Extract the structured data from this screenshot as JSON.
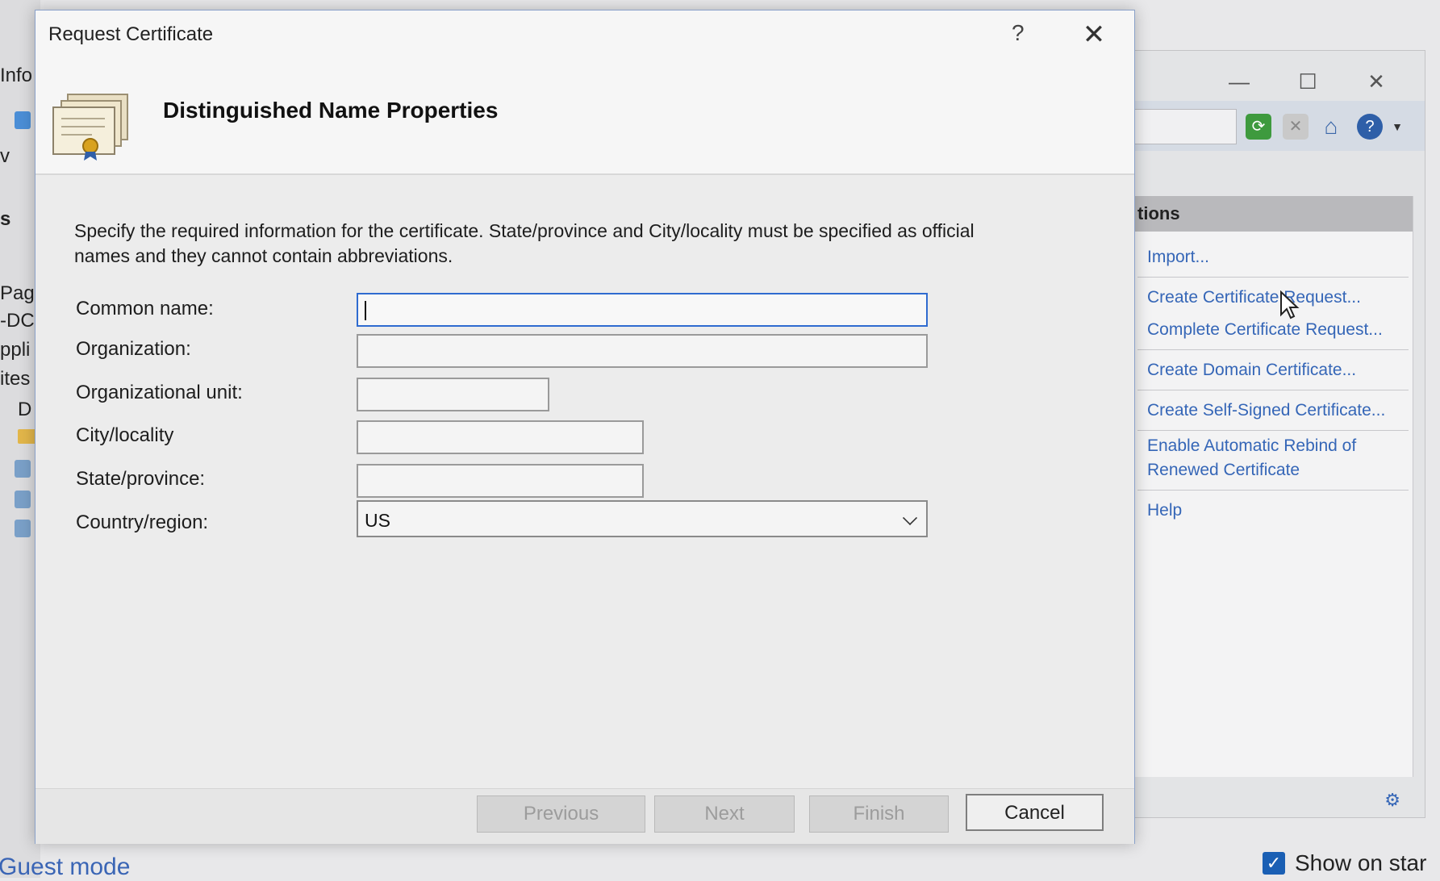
{
  "background_window": {
    "left_fragments": [
      "Info",
      "v",
      "s",
      "Pag",
      "-DCI",
      "ppli",
      "ites",
      "D"
    ],
    "actions_header": "tions",
    "actions": [
      "Import...",
      "Create Certificate Request...",
      "Complete Certificate Request...",
      "Create Domain Certificate...",
      "Create Self-Signed Certificate...",
      "Enable Automatic Rebind of",
      "Renewed Certificate",
      "Help"
    ],
    "window_controls": {
      "minimize": "—",
      "maximize": "☐",
      "close": "✕"
    },
    "bottom_left_text": "Guest mode",
    "show_on_start_label": "Show on star"
  },
  "dialog": {
    "title": "Request Certificate",
    "help_glyph": "?",
    "close_glyph": "✕",
    "heading": "Distinguished Name Properties",
    "instructions": "Specify the required information for the certificate. State/province and City/locality must be specified as official names and they cannot contain abbreviations.",
    "fields": {
      "common_name": {
        "label": "Common name:",
        "value": ""
      },
      "organization": {
        "label": "Organization:",
        "value": ""
      },
      "org_unit": {
        "label": "Organizational unit:",
        "value": ""
      },
      "city": {
        "label": "City/locality",
        "value": ""
      },
      "state": {
        "label": "State/province:",
        "value": ""
      },
      "country": {
        "label": "Country/region:",
        "value": "US"
      }
    },
    "buttons": {
      "previous": "Previous",
      "next": "Next",
      "finish": "Finish",
      "cancel": "Cancel"
    }
  }
}
